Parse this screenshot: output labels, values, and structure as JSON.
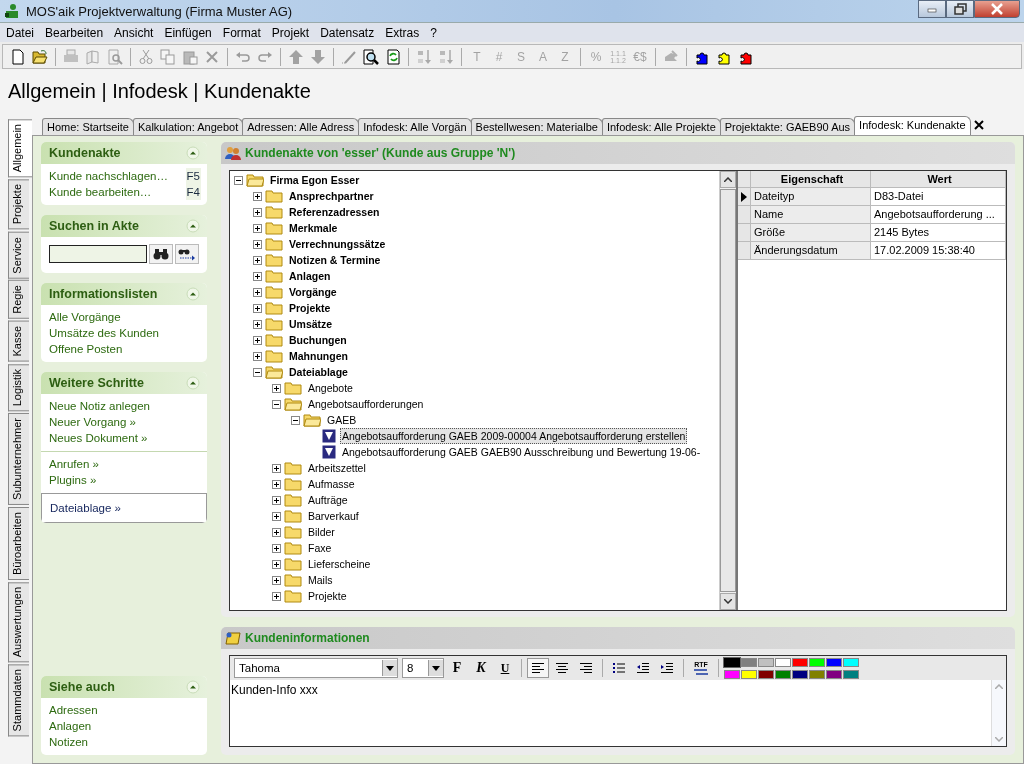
{
  "window": {
    "title": "MOS'aik Projektverwaltung (Firma Muster AG)"
  },
  "menu": [
    "Datei",
    "Bearbeiten",
    "Ansicht",
    "Einfügen",
    "Format",
    "Projekt",
    "Datensatz",
    "Extras",
    "?"
  ],
  "toolbar": [
    [
      {
        "kind": "new",
        "disabled": false
      },
      {
        "kind": "open",
        "disabled": false
      }
    ],
    [
      {
        "kind": "print",
        "disabled": true
      },
      {
        "kind": "pages",
        "disabled": true
      },
      {
        "kind": "preview",
        "disabled": true
      }
    ],
    [
      {
        "kind": "cut",
        "disabled": true
      },
      {
        "kind": "copy",
        "disabled": true
      },
      {
        "kind": "paste",
        "disabled": true
      },
      {
        "kind": "delete",
        "disabled": true
      }
    ],
    [
      {
        "kind": "undo",
        "disabled": true
      },
      {
        "kind": "redo",
        "disabled": true
      }
    ],
    [
      {
        "kind": "up",
        "disabled": true
      },
      {
        "kind": "down",
        "disabled": true
      }
    ],
    [
      {
        "kind": "edit",
        "disabled": true
      },
      {
        "kind": "find",
        "disabled": false
      },
      {
        "kind": "refresh",
        "disabled": false
      }
    ],
    [
      {
        "kind": "sort-az",
        "disabled": true
      },
      {
        "kind": "sort-za",
        "disabled": true
      }
    ],
    [
      {
        "kind": "letter",
        "label": "T",
        "disabled": true
      },
      {
        "kind": "letter",
        "label": "#",
        "disabled": true
      },
      {
        "kind": "letter",
        "label": "S",
        "disabled": true
      },
      {
        "kind": "letter",
        "label": "A",
        "disabled": true
      },
      {
        "kind": "letter",
        "label": "Z",
        "disabled": true
      }
    ],
    [
      {
        "kind": "letter",
        "label": "%",
        "disabled": true
      },
      {
        "kind": "small",
        "label": "1.1.1 1.1.2",
        "disabled": true
      },
      {
        "kind": "letter",
        "label": "€$",
        "disabled": true
      }
    ],
    [
      {
        "kind": "tool",
        "disabled": true
      }
    ],
    [
      {
        "kind": "puzzle",
        "color": "#0000ff",
        "disabled": false
      },
      {
        "kind": "puzzle",
        "color": "#ffff00",
        "disabled": false
      },
      {
        "kind": "puzzle",
        "color": "#ff0000",
        "disabled": false
      }
    ]
  ],
  "breadcrumb": "Allgemein | Infodesk | Kundenakte",
  "tabs": [
    {
      "label": "Home: Startseite",
      "selected": false
    },
    {
      "label": "Kalkulation: Angebot",
      "selected": false
    },
    {
      "label": "Adressen: Alle Adress",
      "selected": false
    },
    {
      "label": "Infodesk: Alle Vorgän",
      "selected": false
    },
    {
      "label": "Bestellwesen: Materialbe",
      "selected": false
    },
    {
      "label": "Infodesk: Alle Projekte",
      "selected": false
    },
    {
      "label": "Projektakte: GAEB90 Aus",
      "selected": false
    },
    {
      "label": "Infodesk: Kundenakte",
      "selected": true
    }
  ],
  "side_tabs": [
    {
      "label": "Allgemein",
      "selected": true
    },
    {
      "label": "Projekte",
      "selected": false
    },
    {
      "label": "Service",
      "selected": false
    },
    {
      "label": "Regie",
      "selected": false
    },
    {
      "label": "Kasse",
      "selected": false
    },
    {
      "label": "Logistik",
      "selected": false
    },
    {
      "label": "Subunternehmer",
      "selected": false
    },
    {
      "label": "Büroarbeiten",
      "selected": false
    },
    {
      "label": "Auswertungen",
      "selected": false
    },
    {
      "label": "Stammdaten",
      "selected": false
    }
  ],
  "sections": [
    {
      "title": "Kundenakte",
      "kind": "links",
      "groups": [
        {
          "selected": false,
          "items": [
            {
              "label": "Kunde nachschlagen…",
              "key": "F5"
            },
            {
              "label": "Kunde bearbeiten…",
              "key": "F4"
            }
          ]
        }
      ]
    },
    {
      "title": "Suchen in Akte",
      "kind": "search"
    },
    {
      "title": "Informationslisten",
      "kind": "links",
      "groups": [
        {
          "selected": false,
          "items": [
            {
              "label": "Alle Vorgänge"
            },
            {
              "label": "Umsätze des Kunden"
            },
            {
              "label": "Offene Posten"
            }
          ]
        }
      ]
    },
    {
      "title": "Weitere Schritte",
      "kind": "links",
      "groups": [
        {
          "selected": false,
          "items": [
            {
              "label": "Neue Notiz anlegen"
            },
            {
              "label": "Neuer Vorgang »"
            },
            {
              "label": "Neues Dokument »"
            }
          ]
        },
        {
          "selected": false,
          "items": [
            {
              "label": "Anrufen »"
            },
            {
              "label": "Plugins »"
            }
          ]
        },
        {
          "selected": true,
          "items": [
            {
              "label": "Dateiablage »"
            }
          ]
        }
      ]
    }
  ],
  "see_also": {
    "title": "Siehe auch",
    "groups": [
      {
        "selected": false,
        "items": [
          {
            "label": "Adressen"
          },
          {
            "label": "Anlagen"
          },
          {
            "label": "Notizen"
          }
        ]
      }
    ]
  },
  "file_panel": {
    "title": "Kundenakte von 'esser' (Kunde aus Gruppe 'N')",
    "tree": [
      {
        "label": "Firma Egon Esser",
        "kind": "folder",
        "expanded": true,
        "selected": false,
        "children": [
          {
            "label": "Ansprechpartner",
            "kind": "folder",
            "expanded": false,
            "selected": false
          },
          {
            "label": "Referenzadressen",
            "kind": "folder",
            "expanded": false,
            "selected": false
          },
          {
            "label": "Merkmale",
            "kind": "folder",
            "expanded": false,
            "selected": false
          },
          {
            "label": "Verrechnungssätze",
            "kind": "folder",
            "expanded": false,
            "selected": false
          },
          {
            "label": "Notizen & Termine",
            "kind": "folder",
            "expanded": false,
            "selected": false
          },
          {
            "label": "Anlagen",
            "kind": "folder",
            "expanded": false,
            "selected": false
          },
          {
            "label": "Vorgänge",
            "kind": "folder",
            "expanded": false,
            "selected": false
          },
          {
            "label": "Projekte",
            "kind": "folder",
            "expanded": false,
            "selected": false
          },
          {
            "label": "Umsätze",
            "kind": "folder",
            "expanded": false,
            "selected": false
          },
          {
            "label": "Buchungen",
            "kind": "folder",
            "expanded": false,
            "selected": false
          },
          {
            "label": "Mahnungen",
            "kind": "folder",
            "expanded": false,
            "selected": false
          },
          {
            "label": "Dateiablage",
            "kind": "folder",
            "expanded": true,
            "selected": false,
            "children": [
              {
                "label": "Angebote",
                "kind": "folder",
                "expanded": false,
                "selected": false
              },
              {
                "label": "Angebotsaufforderungen",
                "kind": "folder",
                "expanded": true,
                "selected": false,
                "children": [
                  {
                    "label": "GAEB",
                    "kind": "folder",
                    "expanded": true,
                    "selected": false,
                    "children": [
                      {
                        "label": "Angebotsaufforderung GAEB 2009-00004 Angebotsaufforderung erstellen",
                        "kind": "file",
                        "selected": true
                      },
                      {
                        "label": "Angebotsaufforderung GAEB GAEB90 Ausschreibung und Bewertung 19-06-",
                        "kind": "file",
                        "selected": false
                      }
                    ]
                  }
                ]
              },
              {
                "label": "Arbeitszettel",
                "kind": "folder",
                "expanded": false,
                "selected": false
              },
              {
                "label": "Aufmasse",
                "kind": "folder",
                "expanded": false,
                "selected": false
              },
              {
                "label": "Aufträge",
                "kind": "folder",
                "expanded": false,
                "selected": false
              },
              {
                "label": "Barverkauf",
                "kind": "folder",
                "expanded": false,
                "selected": false
              },
              {
                "label": "Bilder",
                "kind": "folder",
                "expanded": false,
                "selected": false
              },
              {
                "label": "Faxe",
                "kind": "folder",
                "expanded": false,
                "selected": false
              },
              {
                "label": "Lieferscheine",
                "kind": "folder",
                "expanded": false,
                "selected": false
              },
              {
                "label": "Mails",
                "kind": "folder",
                "expanded": false,
                "selected": false
              },
              {
                "label": "Projekte",
                "kind": "folder",
                "expanded": false,
                "selected": false
              }
            ]
          }
        ]
      }
    ],
    "properties": {
      "columns": [
        "Eigenschaft",
        "Wert"
      ],
      "rows": [
        {
          "name": "Dateityp",
          "value": "D83-Datei",
          "selected": true
        },
        {
          "name": "Name",
          "value": "Angebotsaufforderung ...",
          "selected": false
        },
        {
          "name": "Größe",
          "value": "2145 Bytes",
          "selected": false
        },
        {
          "name": "Änderungsdatum",
          "value": "17.02.2009 15:38:40",
          "selected": false
        }
      ]
    }
  },
  "info_panel": {
    "title": "Kundeninformationen",
    "font": "Tahoma",
    "size": "8",
    "format_buttons": [
      {
        "label": "F",
        "kind": "bold"
      },
      {
        "label": "K",
        "kind": "italic"
      },
      {
        "label": "U",
        "kind": "underline"
      }
    ],
    "align": [
      {
        "kind": "left",
        "selected": true
      },
      {
        "kind": "center",
        "selected": false
      },
      {
        "kind": "right",
        "selected": false
      }
    ],
    "list_tools": [
      {
        "kind": "bullets"
      },
      {
        "kind": "outdent"
      },
      {
        "kind": "indent"
      }
    ],
    "rtf": "RTF",
    "colors": [
      {
        "color": "#000000",
        "selected": true
      },
      {
        "color": "#808080",
        "selected": false
      },
      {
        "color": "#c0c0c0",
        "selected": false
      },
      {
        "color": "#ffffff",
        "selected": false
      },
      {
        "color": "#ff0000",
        "selected": false
      },
      {
        "color": "#00ff00",
        "selected": false
      },
      {
        "color": "#0000ff",
        "selected": false
      },
      {
        "color": "#00ffff",
        "selected": false
      },
      {
        "color": "#ff00ff",
        "selected": false
      },
      {
        "color": "#ffff00",
        "selected": false
      },
      {
        "color": "#800000",
        "selected": false
      },
      {
        "color": "#008000",
        "selected": false
      },
      {
        "color": "#000080",
        "selected": false
      },
      {
        "color": "#808000",
        "selected": false
      },
      {
        "color": "#800080",
        "selected": false
      },
      {
        "color": "#008080",
        "selected": false
      }
    ],
    "text": "Kunden-Info xxx"
  }
}
